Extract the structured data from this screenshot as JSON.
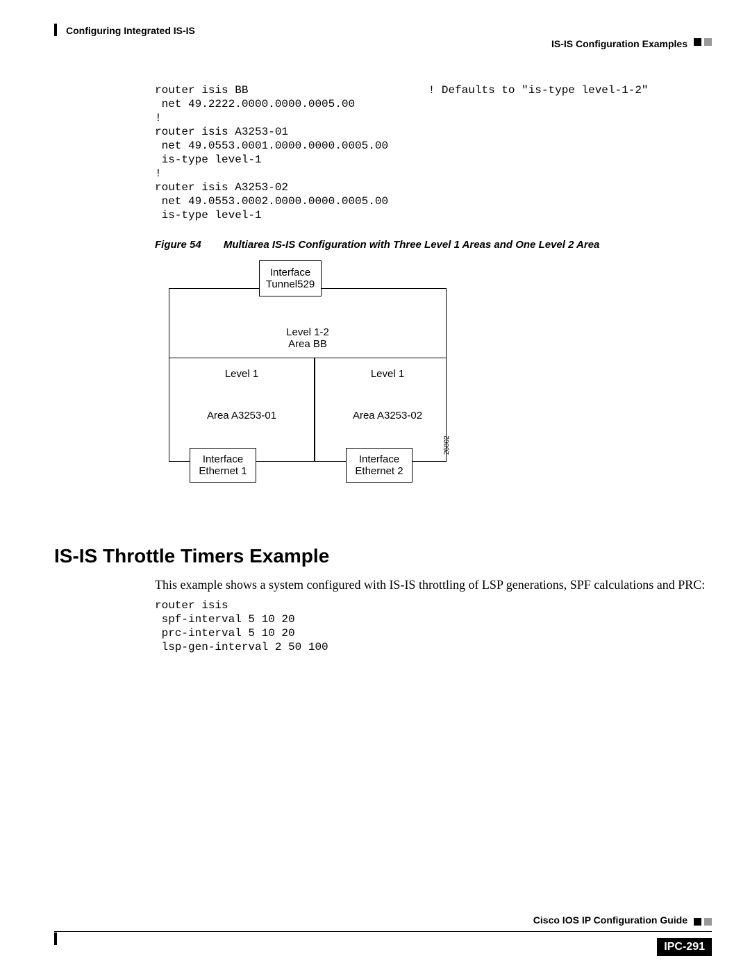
{
  "header": {
    "chapter": "Configuring Integrated IS-IS",
    "section": "IS-IS Configuration Examples"
  },
  "footer": {
    "guide": "Cisco IOS IP Configuration Guide",
    "pagenum": "IPC-291"
  },
  "code1": "router isis BB                           ! Defaults to \"is-type level-1-2\"\n net 49.2222.0000.0000.0005.00\n!\nrouter isis A3253-01\n net 49.0553.0001.0000.0000.0005.00\n is-type level-1\n!\nrouter isis A3253-02\n net 49.0553.0002.0000.0000.0005.00\n is-type level-1",
  "figure": {
    "label": "Figure 54",
    "caption": "Multiarea IS-IS Configuration with Three Level 1 Areas and One Level 2 Area",
    "top_if": "Interface\nTunnel529",
    "level12": "Level 1-2",
    "areabb": "Area BB",
    "level1": "Level 1",
    "area1": "Area A3253-01",
    "area2": "Area A3253-02",
    "if1": "Interface\nEthernet 1",
    "if2": "Interface\nEthernet 2",
    "sidenum": "26802"
  },
  "section2": {
    "heading": "IS-IS Throttle Timers Example",
    "para": "This example shows a system configured with IS-IS throttling of LSP generations, SPF calculations and PRC:",
    "code": "router isis\n spf-interval 5 10 20\n prc-interval 5 10 20\n lsp-gen-interval 2 50 100"
  }
}
